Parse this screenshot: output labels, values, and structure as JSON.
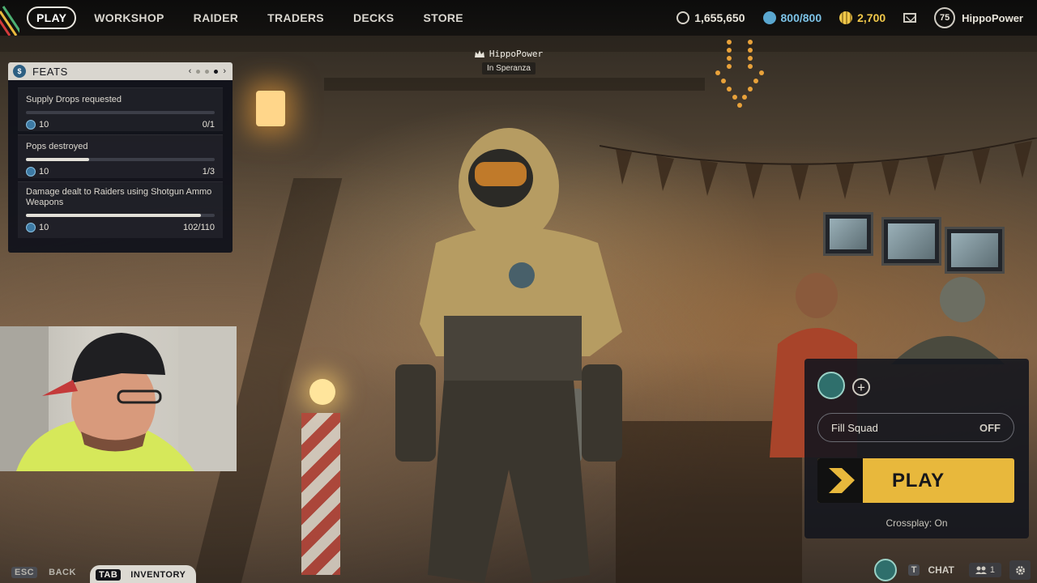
{
  "nav": {
    "items": [
      {
        "label": "PLAY",
        "active": true
      },
      {
        "label": "WORKSHOP",
        "active": false
      },
      {
        "label": "RAIDER",
        "active": false
      },
      {
        "label": "TRADERS",
        "active": false
      },
      {
        "label": "DECKS",
        "active": false
      },
      {
        "label": "STORE",
        "active": false
      }
    ]
  },
  "currencies": {
    "coins": "1,655,650",
    "credits": "800/800",
    "gold": "2,700"
  },
  "profile": {
    "level": "75",
    "username": "HippoPower"
  },
  "player_tag": {
    "name": "HippoPower",
    "location": "In Speranza"
  },
  "feats": {
    "title": "FEATS",
    "pages": 3,
    "current_page": 3,
    "items": [
      {
        "name": "Supply Drops requested",
        "reward": "10",
        "progress_text": "0/1",
        "progress": 0.0
      },
      {
        "name": "Pops destroyed",
        "reward": "10",
        "progress_text": "1/3",
        "progress": 0.333
      },
      {
        "name": "Damage dealt to Raiders using Shotgun Ammo Weapons",
        "reward": "10",
        "progress_text": "102/110",
        "progress": 0.927
      }
    ]
  },
  "play_panel": {
    "fill_squad_label": "Fill Squad",
    "fill_squad_state": "OFF",
    "play_label": "PLAY",
    "crossplay": "Crossplay: On",
    "accent": "#e8b83c"
  },
  "bottom": {
    "esc_key": "ESC",
    "esc_label": "BACK",
    "tab_key": "TAB",
    "tab_label": "INVENTORY",
    "chat_key": "T",
    "chat_label": "CHAT",
    "friends_count": "1"
  }
}
